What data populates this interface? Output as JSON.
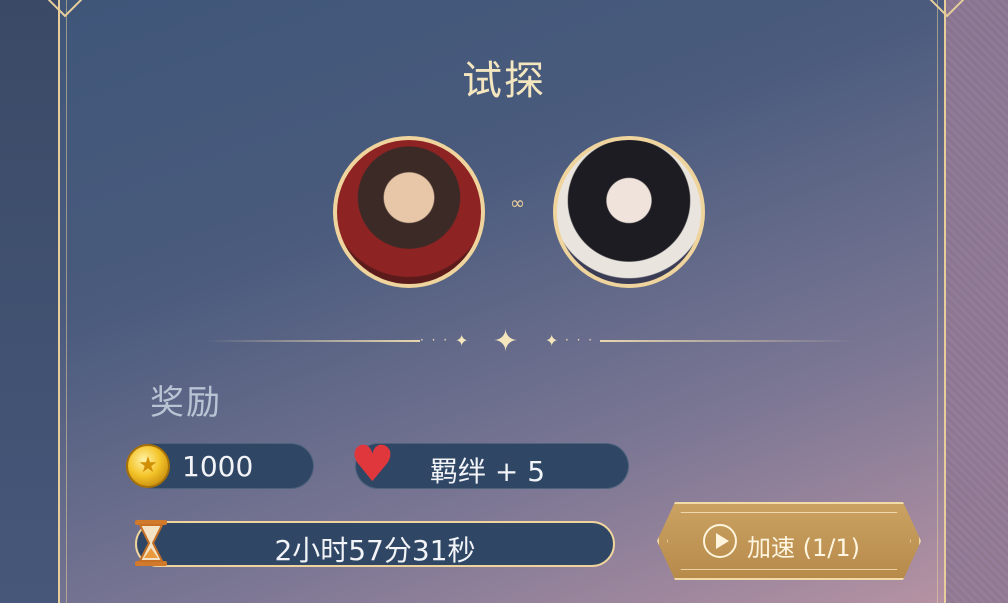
{
  "dialog": {
    "title": "试探",
    "connector_icon": "infinity-link-icon",
    "avatars": [
      {
        "name": "character-avatar-male"
      },
      {
        "name": "character-avatar-female"
      }
    ]
  },
  "rewards": {
    "label": "奖励",
    "coin": {
      "icon": "gold-coin-icon",
      "value": "1000"
    },
    "bond": {
      "icon": "heart-icon",
      "value": "羁绊 + 5"
    }
  },
  "timer": {
    "icon": "hourglass-icon",
    "value": "2小时57分31秒"
  },
  "speed_button": {
    "icon": "play-icon",
    "label": "加速 (1/1)"
  },
  "colors": {
    "gold": "#f0d49d",
    "panel": "#2f4765",
    "heart": "#e0373d"
  }
}
